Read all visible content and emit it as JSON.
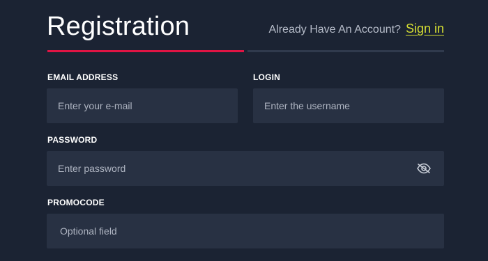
{
  "header": {
    "title": "Registration",
    "account_prompt": "Already Have An Account?",
    "signin_label": "Sign in"
  },
  "form": {
    "email": {
      "label": "EMAIL ADDRESS",
      "placeholder": "Enter your e-mail",
      "value": ""
    },
    "login": {
      "label": "LOGIN",
      "placeholder": "Enter the username",
      "value": ""
    },
    "password": {
      "label": "PASSWORD",
      "placeholder": "Enter password",
      "value": ""
    },
    "promocode": {
      "label": "PROMOCODE",
      "placeholder": "Optional field",
      "value": ""
    }
  },
  "icons": {
    "password_toggle": "eye-slash-icon"
  },
  "colors": {
    "background": "#1b2333",
    "field_background": "#283143",
    "accent_tab": "#e01444",
    "inactive_tab": "#303a4d",
    "signin_link": "#d6df33"
  }
}
